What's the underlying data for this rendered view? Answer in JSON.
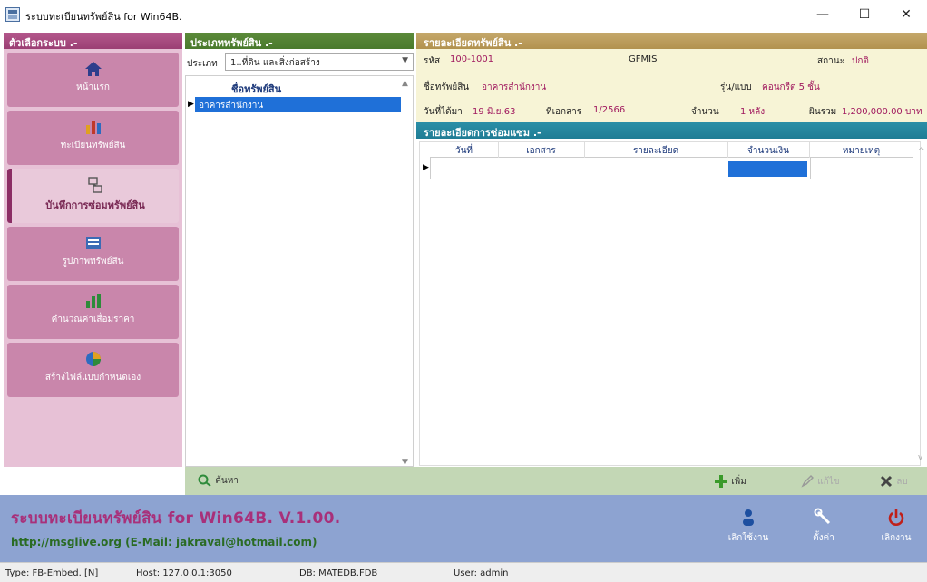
{
  "window": {
    "title": "ระบบทะเบียนทรัพย์สิน for Win64B.",
    "minimize": "—",
    "maximize": "☐",
    "close": "✕"
  },
  "left_menu": {
    "header": "ตัวเลือกระบบ .-",
    "items": [
      {
        "label": "หน้าแรก",
        "icon": "home-icon"
      },
      {
        "label": "ทะเบียนทรัพย์สิน",
        "icon": "bar-chart-icon"
      },
      {
        "label": "บันทึกการซ่อมทรัพย์สิน",
        "icon": "repair-doc-icon"
      },
      {
        "label": "รูปภาพทรัพย์สิน",
        "icon": "news-image-icon"
      },
      {
        "label": "คำนวณค่าเสื่อมราคา",
        "icon": "calc-chart-icon"
      },
      {
        "label": "สร้างไฟล์แบบกำหนดเอง",
        "icon": "pie-chart-icon"
      }
    ]
  },
  "category": {
    "header": "ประเภททรัพย์สิน .-",
    "label": "ประเภท",
    "selected": "1..ที่ดิน และสิ่งก่อสร้าง",
    "tree_header": "ชื่อทรัพย์สิน",
    "tree_items": [
      "อาคารสำนักงาน"
    ]
  },
  "detail": {
    "header": "รายละเอียดทรัพย์สิน .-",
    "code_label": "รหัส",
    "code_value": "100-1001",
    "gfmis_label": "GFMIS",
    "status_label": "สถานะ",
    "status_value": "ปกติ",
    "name_label": "ชื่อทรัพย์สิน",
    "name_value": "อาคารสำนักงาน",
    "model_label": "รุ่น/แบบ",
    "model_value": "คอนกรีต 5 ชั้น",
    "date_label": "วันที่ได้มา",
    "date_value": "19 มิ.ย.63",
    "doc_label": "ที่เอกสาร",
    "doc_value": "1/2566",
    "qty_label": "จำนวน",
    "qty_value": "1 หลัง",
    "total_label": "ผินรวม",
    "total_value": "1,200,000.00 บาท"
  },
  "repair": {
    "header": "รายละเอียดการซ่อมแซม .-",
    "columns": [
      "วันที่",
      "เอกสาร",
      "รายละเอียด",
      "จำนวนเงิน",
      "หมายเหตุ"
    ]
  },
  "actions": {
    "search": "ค้นหา",
    "add": "เพิ่ม",
    "edit": "แก้ไข",
    "delete": "ลบ"
  },
  "footer": {
    "title": "ระบบทะเบียนทรัพย์สิน for Win64B. V.1.00.",
    "url": "http://msglive.org (E-Mail: jakraval@hotmail.com)",
    "buttons": [
      {
        "label": "เลิกใช้งาน",
        "icon": "user-icon"
      },
      {
        "label": "ตั้งค่า",
        "icon": "wrench-icon"
      },
      {
        "label": "เลิกงาน",
        "icon": "power-icon"
      }
    ]
  },
  "status": {
    "type": "Type: FB-Embed. [N]",
    "host": "Host: 127.0.0.1:3050",
    "db": "DB: MATEDB.FDB",
    "user": "User: admin"
  },
  "colors": {
    "menu_header": "#9b3f74",
    "category_header": "#4a7a2d",
    "detail_header": "#b2924f",
    "repair_header": "#1f7d95",
    "selection": "#1f70d8",
    "footer": "#8da3d1"
  }
}
